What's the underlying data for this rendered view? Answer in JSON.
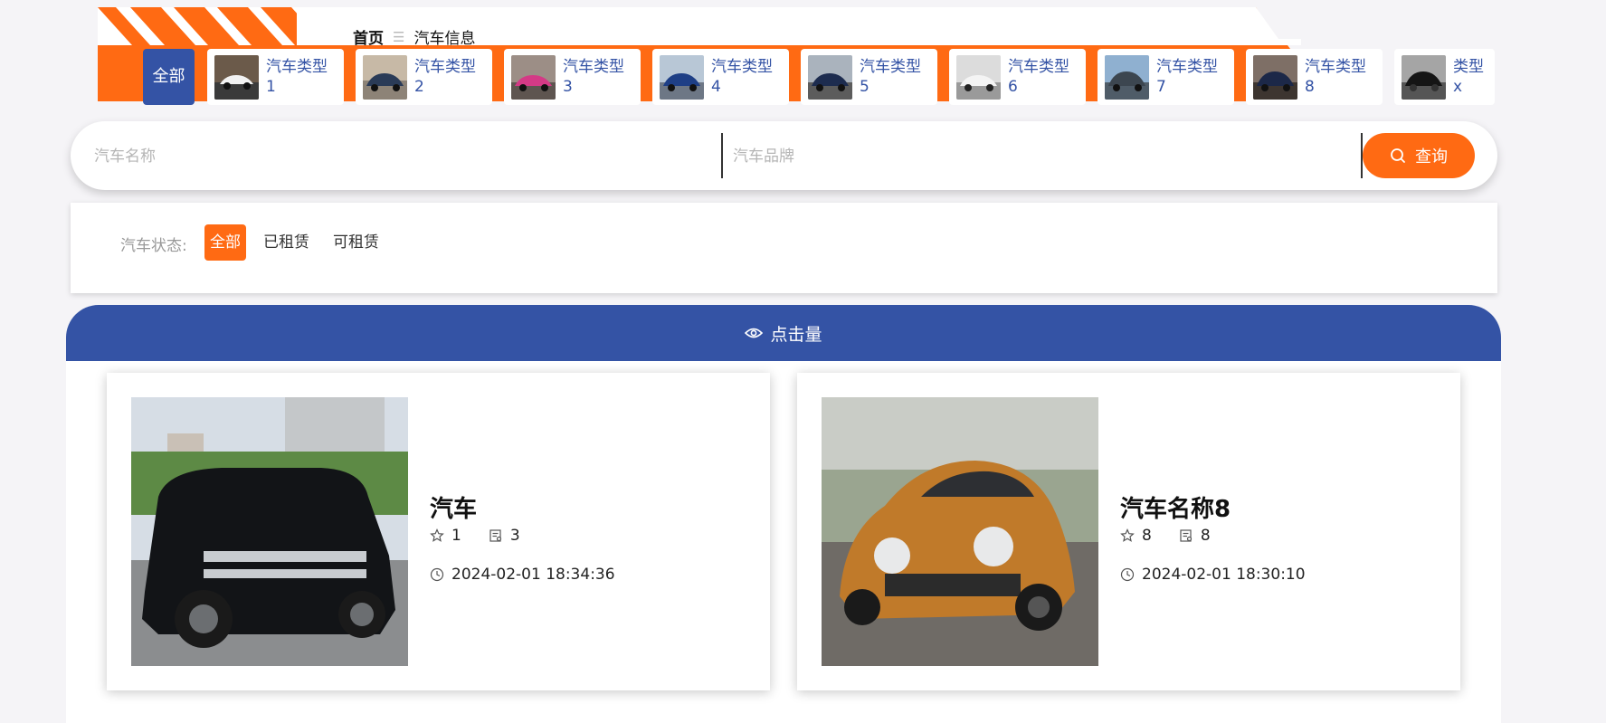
{
  "breadcrumb": {
    "home": "首页",
    "separator": "☰",
    "current": "汽车信息"
  },
  "categories": {
    "all_label": "全部",
    "items": [
      {
        "label": "汽车类型1"
      },
      {
        "label": "汽车类型2"
      },
      {
        "label": "汽车类型3"
      },
      {
        "label": "汽车类型4"
      },
      {
        "label": "汽车类型5"
      },
      {
        "label": "汽车类型6"
      },
      {
        "label": "汽车类型7"
      },
      {
        "label": "汽车类型8"
      },
      {
        "label": "类型x"
      }
    ]
  },
  "search": {
    "name_placeholder": "汽车名称",
    "brand_placeholder": "汽车品牌",
    "button_label": "查询"
  },
  "filter": {
    "label": "汽车状态:",
    "options": [
      "全部",
      "已租赁",
      "可租赁"
    ],
    "selected": "全部"
  },
  "section": {
    "title": "点击量"
  },
  "cars": [
    {
      "name": "汽车",
      "favorites": "1",
      "views": "3",
      "time": "2024-02-01 18:34:36"
    },
    {
      "name": "汽车名称8",
      "favorites": "8",
      "views": "8",
      "time": "2024-02-01 18:30:10"
    }
  ],
  "colors": {
    "brand_blue": "#3453a5",
    "accent_orange": "#ff6a13"
  }
}
